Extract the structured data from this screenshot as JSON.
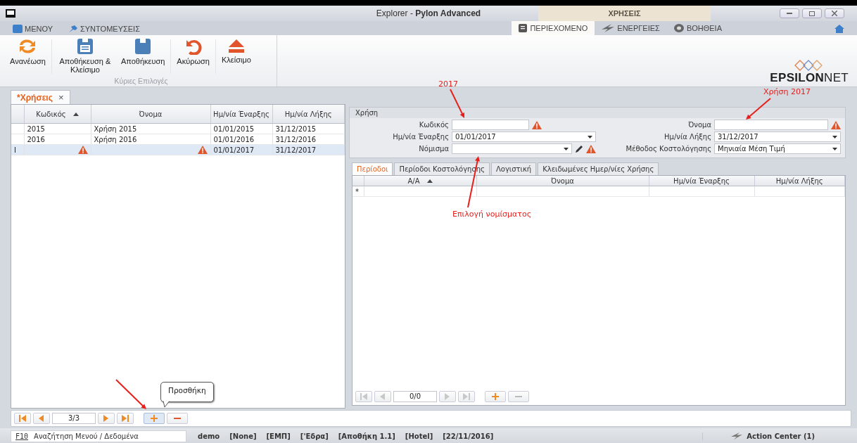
{
  "window": {
    "title": "Explorer - **Pylon Advanced**",
    "context_label": "ΧΡΗΣΕΙΣ"
  },
  "menu": [
    {
      "label": "ΜΕΝΟΥ",
      "kind": "book"
    },
    {
      "label": "ΣΥΝΤΟΜΕΥΣΕΙΣ",
      "kind": "pin"
    }
  ],
  "ribbon_tabs": [
    {
      "label": "ΠΕΡΙΕΧΟΜΕΝΟ",
      "kind": "page",
      "selected": true
    },
    {
      "label": "ΕΝΕΡΓΕΙΕΣ",
      "kind": "bolt",
      "selected": false
    },
    {
      "label": "ΒΟΗΘΕΙΑ",
      "kind": "help",
      "selected": false
    }
  ],
  "ribbon": {
    "group": "Κύριες Επιλογές",
    "buttons": [
      {
        "label": "Ανανέωση",
        "kind": "refresh"
      },
      {
        "label": "Αποθήκευση & Κλείσιμο",
        "kind": "save_close"
      },
      {
        "label": "Αποθήκευση",
        "kind": "save"
      },
      {
        "label": "Ακύρωση",
        "kind": "undo"
      },
      {
        "label": "Κλείσιμο",
        "kind": "eject"
      }
    ]
  },
  "logo": {
    "bold": "EPSILON",
    "light": "NET"
  },
  "document_tabs": [
    {
      "label": "*Χρήσεις",
      "close": "×",
      "selected": true
    }
  ],
  "grid": {
    "columns": [
      {
        "label": "Κωδικός",
        "sorted": true
      },
      {
        "label": "Όνομα",
        "sorted": false
      },
      {
        "label": "Ημ/νία Έναρξης",
        "sorted": false
      },
      {
        "label": "Ημ/νία Λήξης",
        "sorted": false
      }
    ],
    "rows": [
      {
        "code": "2015",
        "name": "Χρήση 2015",
        "start": "01/01/2015",
        "end": "31/12/2015",
        "selected": false,
        "code_warning": false,
        "name_warning": false
      },
      {
        "code": "2016",
        "name": "Χρήση 2016",
        "start": "01/01/2016",
        "end": "31/12/2016",
        "selected": false,
        "code_warning": false,
        "name_warning": false
      },
      {
        "indicator": "I",
        "start": "01/01/2017",
        "end": "31/12/2017",
        "selected": true,
        "code_warning": true,
        "name_warning": true
      }
    ]
  },
  "form": {
    "title": "Χρήση",
    "fields": [
      {
        "label": "Κωδικός",
        "kind": "text",
        "warning": true
      },
      {
        "label": "Όνομα",
        "kind": "text",
        "warning": true
      },
      {
        "label": "Ημ/νία Έναρξης",
        "kind": "dropdown",
        "value": "01/01/2017",
        "warning": false
      },
      {
        "label": "Ημ/νία Λήξης",
        "kind": "dropdown",
        "value": "31/12/2017",
        "warning": false
      },
      {
        "label": "Νόμισμα",
        "kind": "lookup",
        "warning": true
      },
      {
        "label": "Μέθοδος Κοστολόγησης",
        "kind": "dropdown",
        "value": "Μηνιαία Μέση Τιμή",
        "warning": false
      }
    ]
  },
  "sub_tabs": [
    {
      "label": "Περίοδοι",
      "selected": true
    },
    {
      "label": "Περίοδοι Κοστολόγησης",
      "selected": false
    },
    {
      "label": "Λογιστική",
      "selected": false
    },
    {
      "label": "Κλειδωμένες Ημερ/νίες Χρήσης",
      "selected": false
    }
  ],
  "sub_grid": {
    "columns": [
      {
        "label": "Α/Α",
        "sorted": true
      },
      {
        "label": "Όνομα",
        "sorted": false
      },
      {
        "label": "Ημ/νία Έναρξης",
        "sorted": false
      },
      {
        "label": "Ημ/νία Λήξης",
        "sorted": false
      }
    ],
    "new_row_marker": "*"
  },
  "sub_pager": {
    "position": "0/0",
    "disabled": true
  },
  "pager": {
    "position": "3/3",
    "disabled": false
  },
  "tooltip": "Προσθήκη",
  "annotations": [
    {
      "kind": "labeled_arrow",
      "text": "2017"
    },
    {
      "kind": "labeled_arrow",
      "text": "Χρήση 2017"
    },
    {
      "kind": "labeled_arrow",
      "text": "Επιλογή νομίσματος"
    },
    {
      "kind": "arrow"
    }
  ],
  "status_bar": {
    "key": "F10",
    "search": "Αναζήτηση Μενού / Δεδομένα",
    "items": [
      "demo",
      "[None]",
      "[ΕΜΠ]",
      "['Εδρα]",
      "[Αποθήκη 1.1]",
      "[Hotel]",
      "[22/11/2016]"
    ],
    "action_center": "Action Center (1)"
  }
}
